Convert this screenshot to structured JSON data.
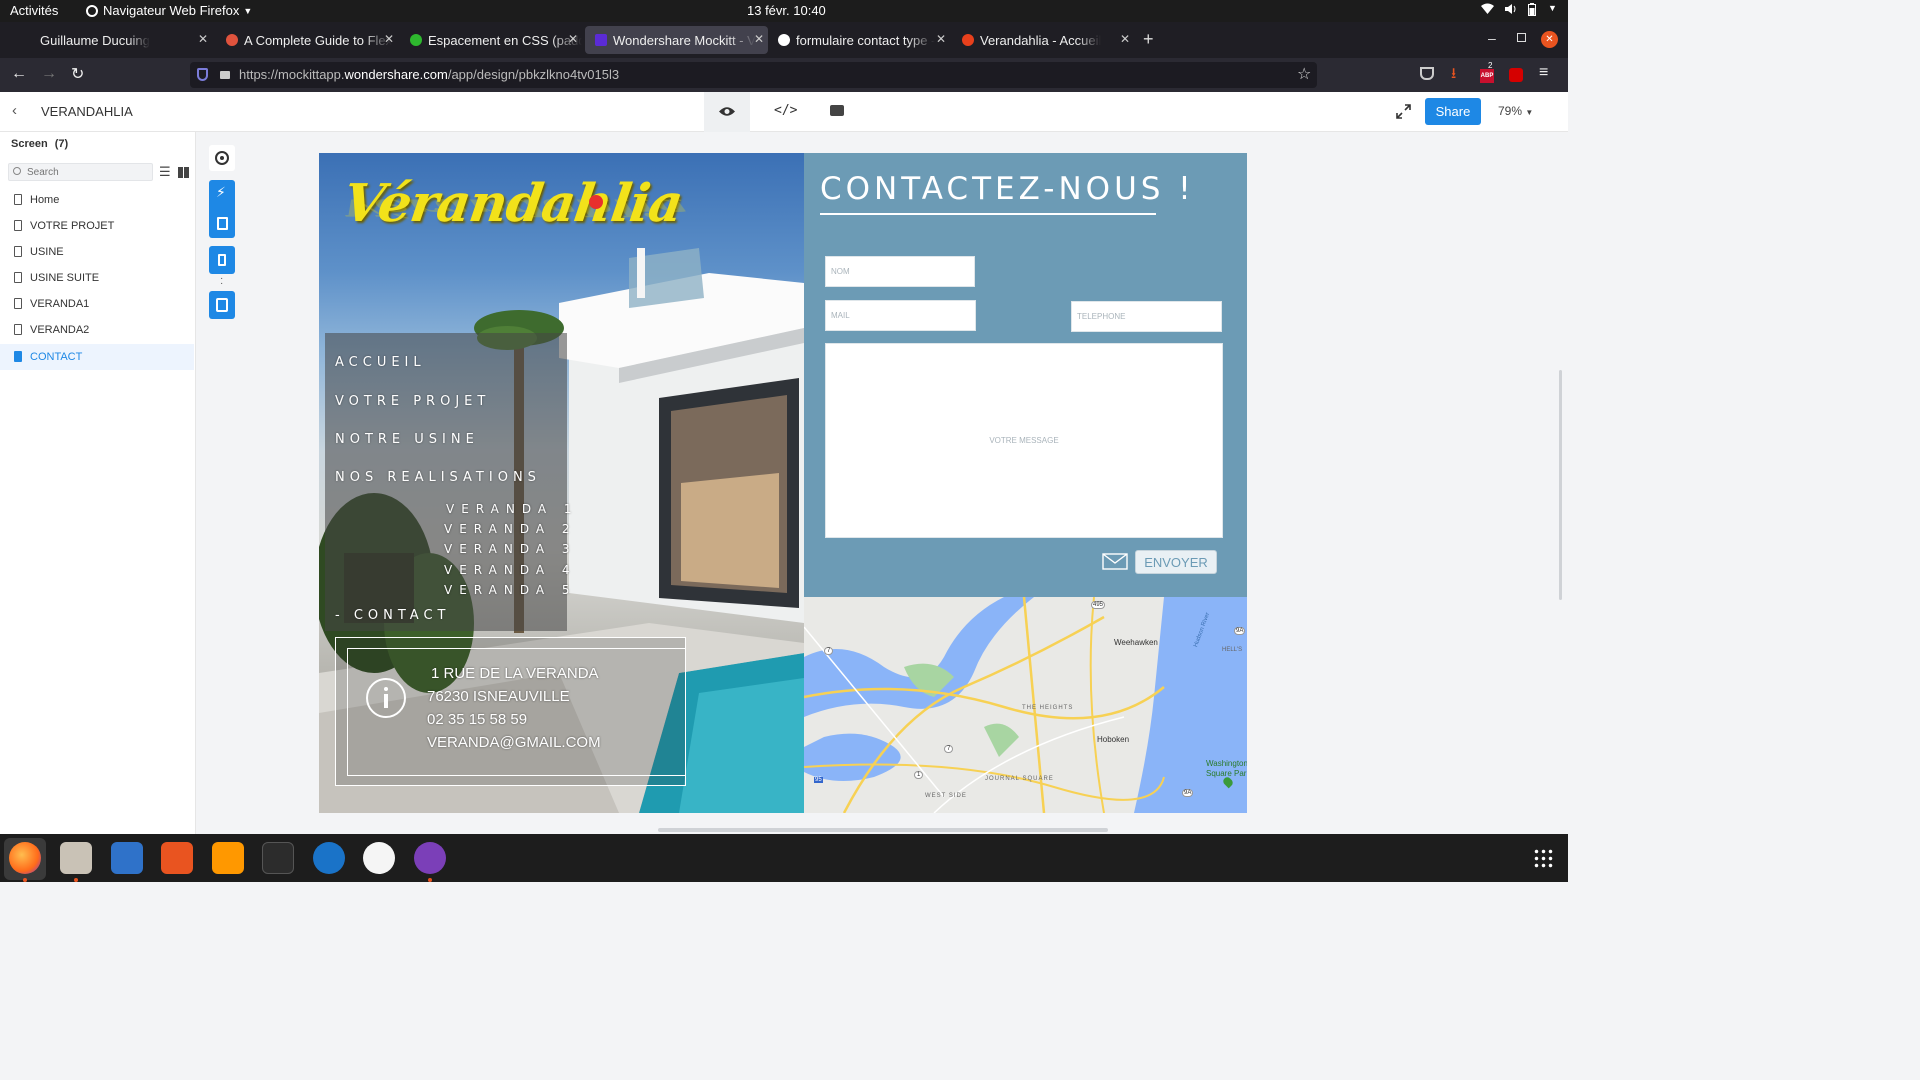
{
  "system": {
    "activities": "Activités",
    "app_name": "Navigateur Web Firefox",
    "datetime": "13 févr.  10:40"
  },
  "tabs": [
    {
      "label": "Guillaume Ducuing",
      "favicon_color": "#1f1e24"
    },
    {
      "label": "A Complete Guide to Flex",
      "favicon_color": "#e0533d"
    },
    {
      "label": "Espacement en CSS (padd",
      "favicon_color": "#2eb82e"
    },
    {
      "label": "Wondershare Mockitt - V",
      "favicon_color": "#5b2bd6",
      "active": true
    },
    {
      "label": "formulaire contact type -",
      "favicon_color": "#ffffff"
    },
    {
      "label": "Verandahlia - Accueil",
      "favicon_color": "#e8401c"
    }
  ],
  "browser": {
    "url_prefix": "https://mockittapp.",
    "url_domain": "wondershare.com",
    "url_path": "/app/design/pbkzlkno4tv015l3",
    "abp_badge": "2"
  },
  "app_header": {
    "project_name": "VERANDAHLIA",
    "share_label": "Share",
    "zoom": "79%"
  },
  "sidebar": {
    "title": "Screen",
    "count": "(7)",
    "search_placeholder": "Search",
    "pages": [
      {
        "label": "Home"
      },
      {
        "label": "VOTRE PROJET"
      },
      {
        "label": "USINE"
      },
      {
        "label": "USINE SUITE"
      },
      {
        "label": "VERANDA1"
      },
      {
        "label": "VERANDA2"
      },
      {
        "label": "CONTACT",
        "selected": true
      }
    ]
  },
  "design": {
    "logo_text": "Vérandahlia",
    "menu": {
      "accueil": "ACCUEIL",
      "votre_projet": "VOTRE PROJET",
      "notre_usine": "NOTRE USINE",
      "nos_realisations": "NOS REALISATIONS",
      "verandas": [
        "VERANDA 1",
        "VERANDA 2",
        "VERANDA 3",
        "VERANDA 4",
        "VERANDA 5"
      ],
      "contact": "- CONTACT"
    },
    "info": {
      "address": "1 RUE DE LA VERANDA",
      "city": "76230 ISNEAUVILLE",
      "phone": "02 35 15 58 59",
      "email": "VERANDA@GMAIL.COM"
    },
    "contact_form": {
      "title": "CONTACTEZ-NOUS !",
      "nom_placeholder": "NOM",
      "mail_placeholder": "MAIL",
      "telephone_placeholder": "TELEPHONE",
      "message_placeholder": "VOTRE MESSAGE",
      "send_label": "ENVOYER"
    },
    "map_labels": {
      "weehawken": "Weehawken",
      "hoboken": "Hoboken",
      "the_heights": "THE HEIGHTS",
      "journal_square": "JOURNAL SQUARE",
      "west_side": "WEST SIDE",
      "washington_1": "Washington",
      "washington_2": "Square Par",
      "hells": "HELL'S",
      "hudson": "Hudson River",
      "r495": "495",
      "r7": "7",
      "r9a": "9A",
      "r1": "1",
      "r95": "95"
    },
    "colors": {
      "panel": "#6c9bb5",
      "accent": "#1e88e5",
      "logo": "#f2e21a"
    }
  }
}
